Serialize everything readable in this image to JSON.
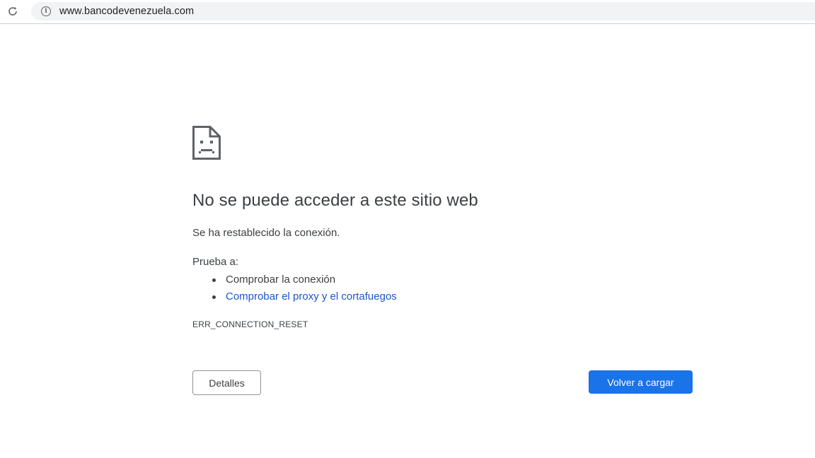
{
  "browser": {
    "reload_icon": "reload-icon",
    "site_info_icon": "info-icon",
    "url": "www.bancodevenezuela.com"
  },
  "error_page": {
    "icon": "sad-page-icon",
    "title": "No se puede acceder a este sitio web",
    "subtitle": "Se ha restablecido la conexión.",
    "try_label": "Prueba a:",
    "suggestions": [
      {
        "text": "Comprobar la conexión",
        "is_link": false
      },
      {
        "text": "Comprobar el proxy y el cortafuegos",
        "is_link": true
      }
    ],
    "error_code": "ERR_CONNECTION_RESET",
    "details_button": "Detalles",
    "reload_button": "Volver a cargar",
    "colors": {
      "link": "#1a57c9",
      "primary_button": "#1a73e8",
      "text": "#3c4043"
    }
  }
}
